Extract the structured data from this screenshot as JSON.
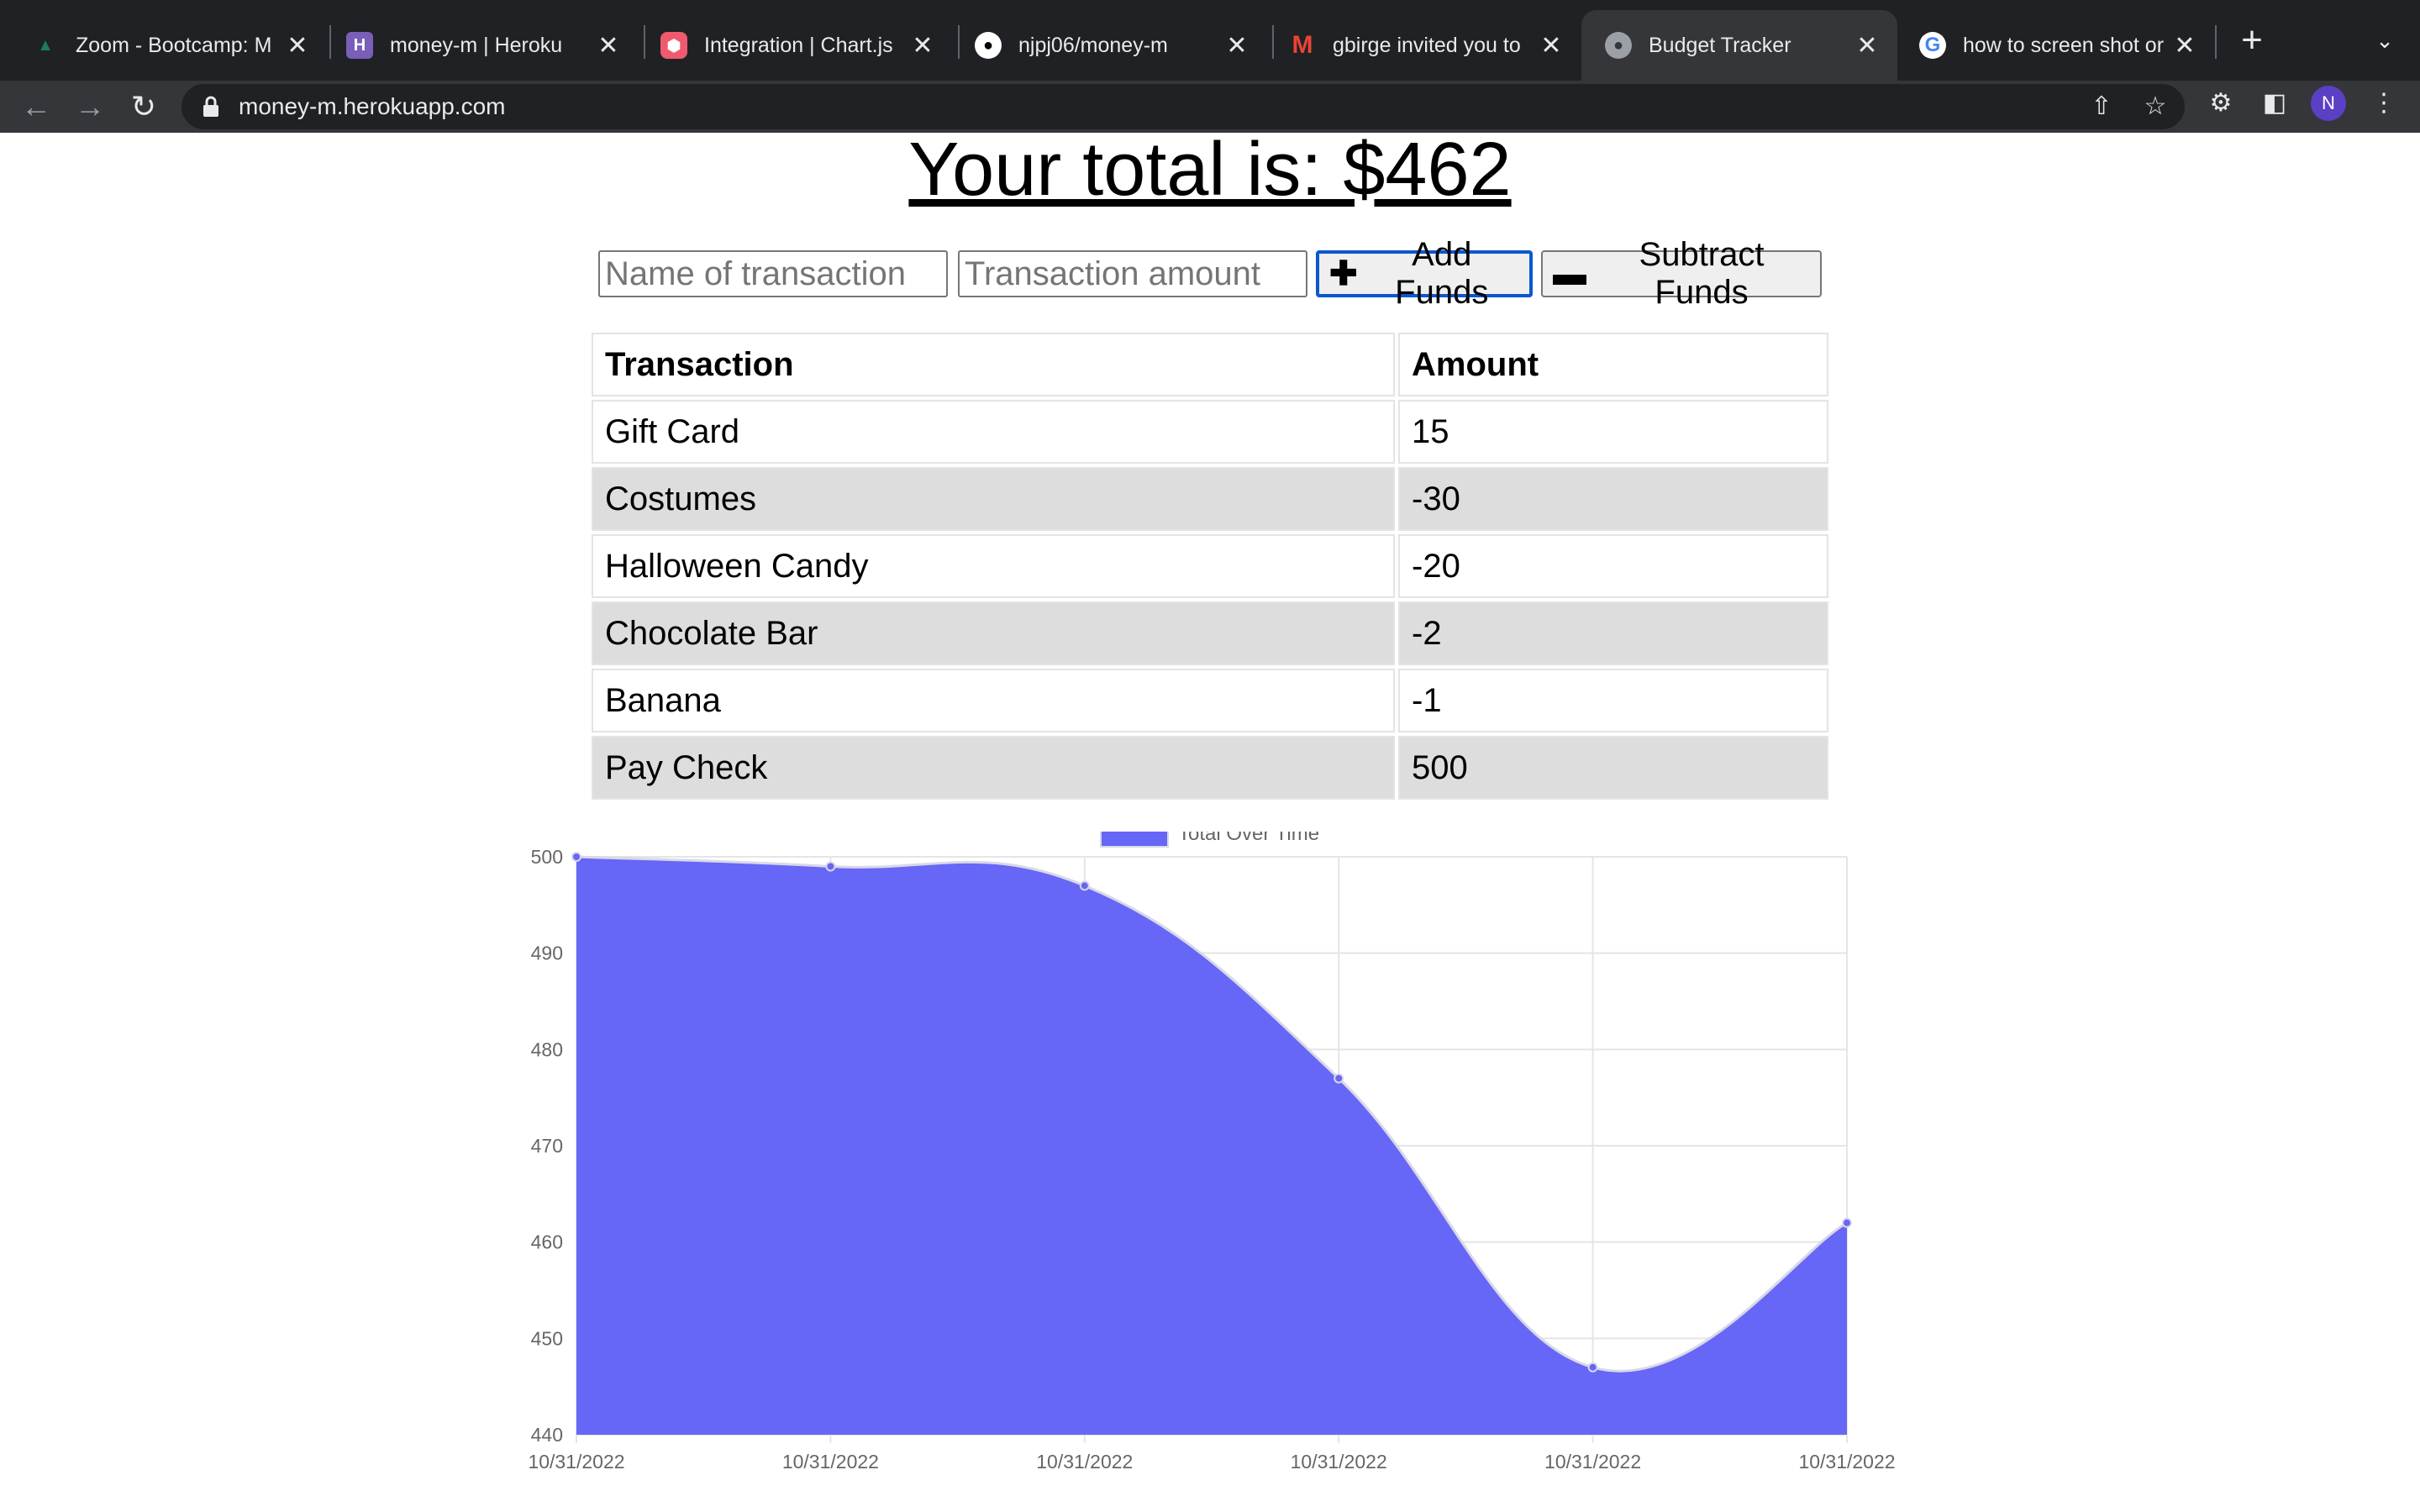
{
  "browser": {
    "tabs": [
      {
        "title": "Zoom - Bootcamp: M",
        "favicon": "zoom-icon",
        "active": false
      },
      {
        "title": "money-m | Heroku",
        "favicon": "heroku-icon",
        "active": false
      },
      {
        "title": "Integration | Chart.js",
        "favicon": "chartjs-icon",
        "active": false
      },
      {
        "title": "njpj06/money-m",
        "favicon": "github-icon",
        "active": false
      },
      {
        "title": "gbirge invited you to",
        "favicon": "gmail-icon",
        "active": false
      },
      {
        "title": "Budget Tracker",
        "favicon": "globe-icon",
        "active": true
      },
      {
        "title": "how to screen shot or",
        "favicon": "google-icon",
        "active": false
      }
    ],
    "url": "money-m.herokuapp.com",
    "profile_initial": "N"
  },
  "page": {
    "total_label": "Your total is: $462",
    "name_placeholder": "Name of transaction",
    "amount_placeholder": "Transaction amount",
    "add_label": "Add Funds",
    "subtract_label": "Subtract Funds",
    "table": {
      "headers": [
        "Transaction",
        "Amount"
      ],
      "rows": [
        {
          "name": "Gift Card",
          "amount": "15"
        },
        {
          "name": "Costumes",
          "amount": "-30"
        },
        {
          "name": "Halloween Candy",
          "amount": "-20"
        },
        {
          "name": "Chocolate Bar",
          "amount": "-2"
        },
        {
          "name": "Banana",
          "amount": "-1"
        },
        {
          "name": "Pay Check",
          "amount": "500"
        }
      ]
    }
  },
  "colors": {
    "accent": "#6666f7",
    "line": "#d8d8e8",
    "focus": "#0b57d0",
    "row_alt": "#dddddd"
  },
  "chart_data": {
    "type": "area",
    "x": [
      "10/31/2022",
      "10/31/2022",
      "10/31/2022",
      "10/31/2022",
      "10/31/2022",
      "10/31/2022"
    ],
    "series": [
      {
        "name": "Total Over Time",
        "values": [
          500,
          499,
          497,
          477,
          447,
          462
        ]
      }
    ],
    "ylim": [
      440,
      500
    ],
    "yticks": [
      440,
      450,
      460,
      470,
      480,
      490,
      500
    ],
    "grid": true,
    "legend": "top-center"
  }
}
